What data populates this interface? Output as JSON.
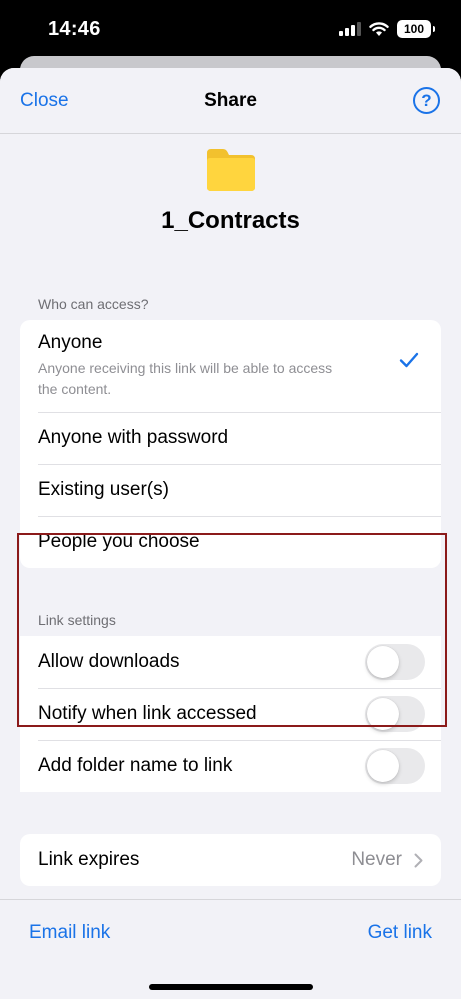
{
  "status_bar": {
    "time": "14:46",
    "battery": "100"
  },
  "nav": {
    "close_label": "Close",
    "title": "Share",
    "help_symbol": "?"
  },
  "folder": {
    "name": "1_Contracts",
    "icon": "folder-icon",
    "icon_color": "#FFD53E"
  },
  "access": {
    "header": "Who can access?",
    "options": [
      {
        "label": "Anyone",
        "description": "Anyone receiving this link will be able to access the content.",
        "selected": true
      },
      {
        "label": "Anyone with password",
        "selected": false
      },
      {
        "label": "Existing user(s)",
        "selected": false
      },
      {
        "label": "People you choose",
        "selected": false
      }
    ]
  },
  "link_settings": {
    "header": "Link settings",
    "toggles": [
      {
        "label": "Allow downloads",
        "on": false
      },
      {
        "label": "Notify when link accessed",
        "on": false
      },
      {
        "label": "Add folder name to link",
        "on": false
      }
    ]
  },
  "expires": {
    "label": "Link expires",
    "value": "Never"
  },
  "bottom": {
    "email_label": "Email link",
    "get_label": "Get link"
  },
  "colors": {
    "accent": "#1A73E8",
    "highlight_border": "#8B1A1A",
    "background": "#F2F2F7"
  }
}
